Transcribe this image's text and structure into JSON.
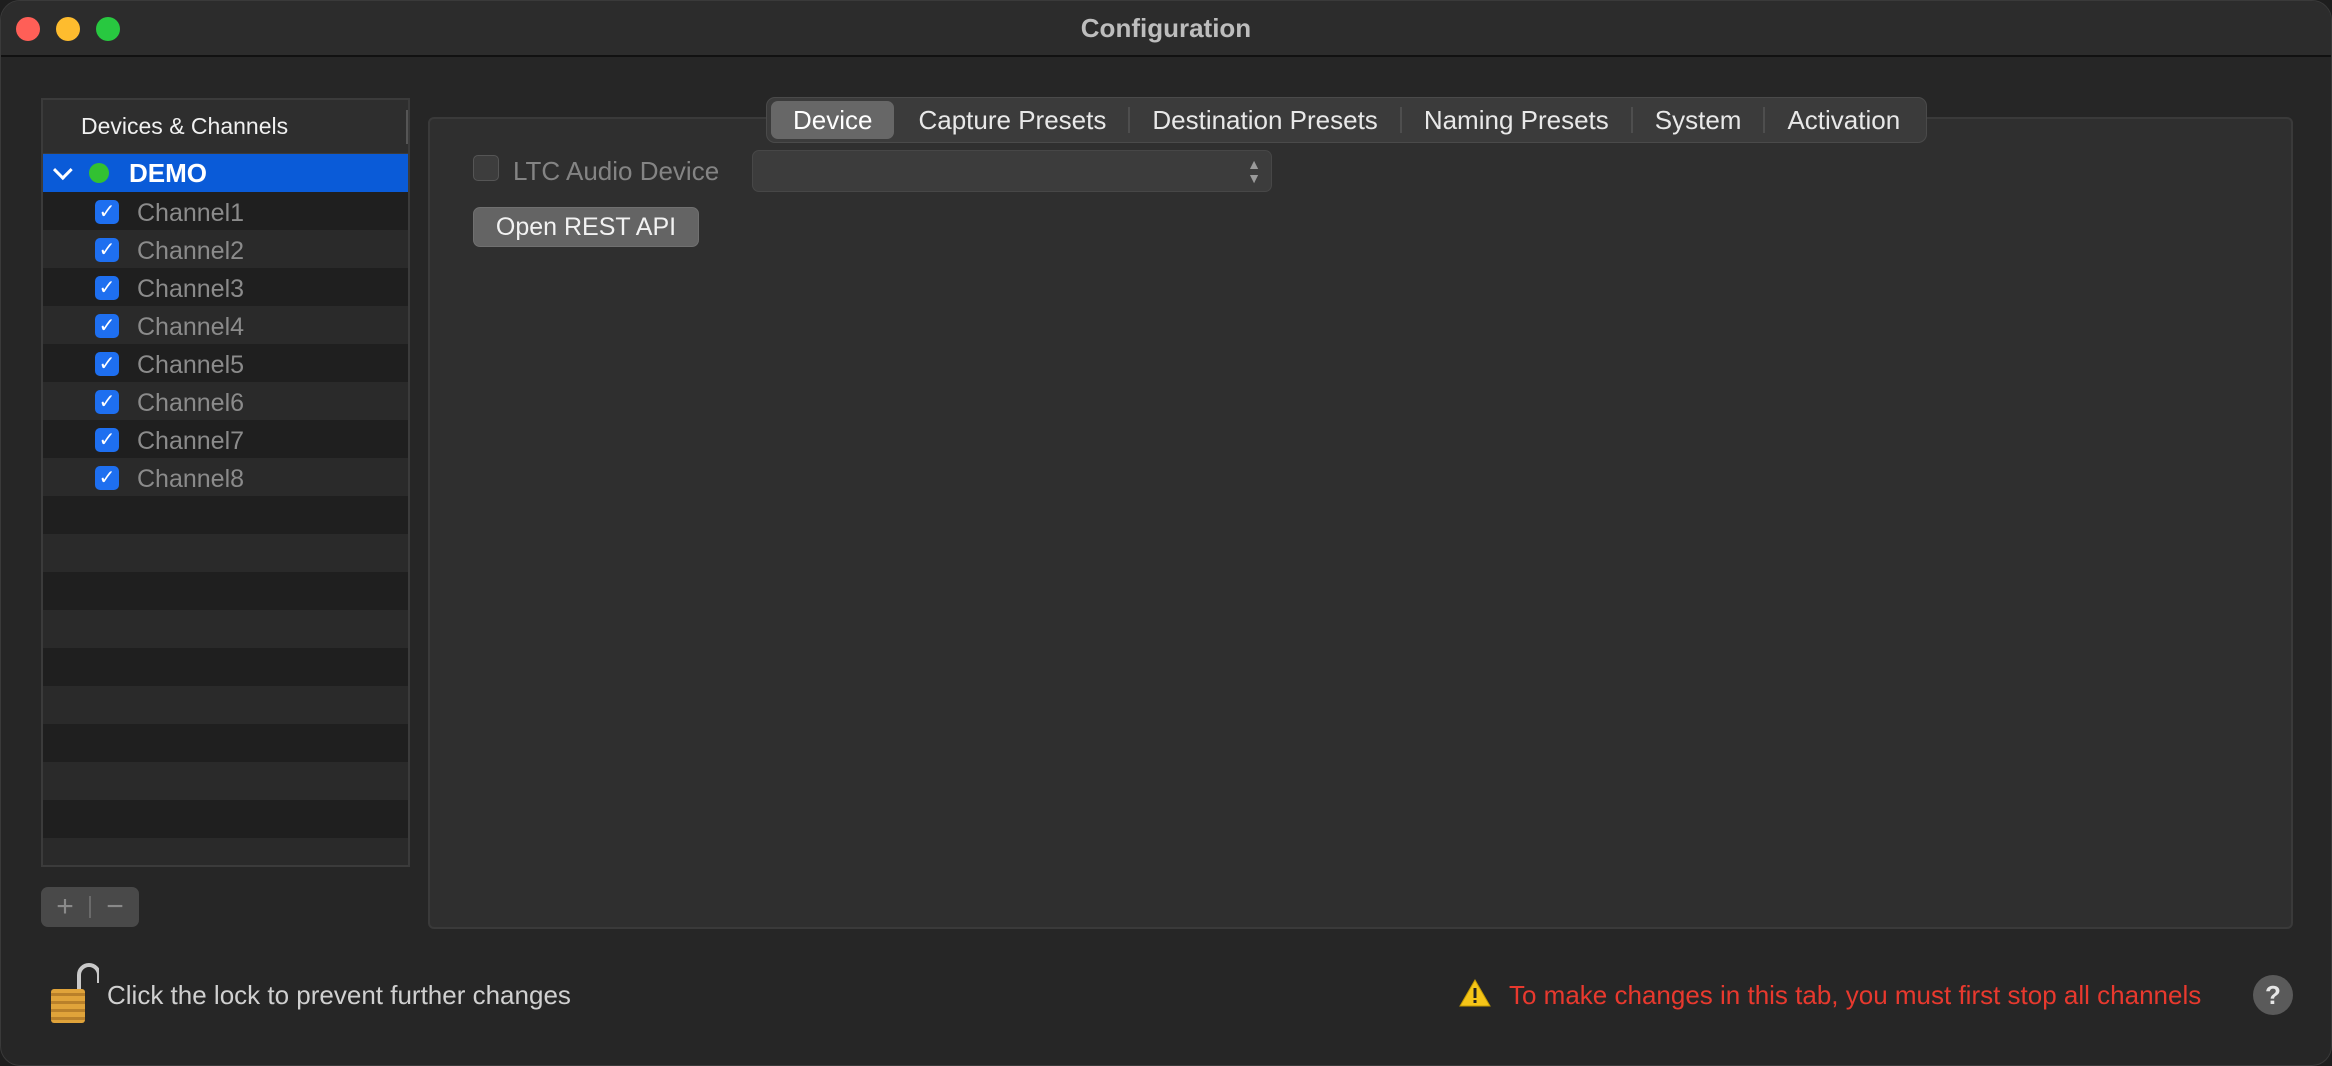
{
  "window": {
    "title": "Configuration"
  },
  "sidebar": {
    "header": "Devices & Channels",
    "device": {
      "label": "DEMO",
      "status_color": "#32c132"
    },
    "channels": [
      "Channel1",
      "Channel2",
      "Channel3",
      "Channel4",
      "Channel5",
      "Channel6",
      "Channel7",
      "Channel8"
    ],
    "add_label": "+",
    "remove_label": "−"
  },
  "tabs": [
    {
      "label": "Device",
      "active": true
    },
    {
      "label": "Capture Presets",
      "active": false
    },
    {
      "label": "Destination Presets",
      "active": false
    },
    {
      "label": "Naming Presets",
      "active": false
    },
    {
      "label": "System",
      "active": false
    },
    {
      "label": "Activation",
      "active": false
    }
  ],
  "device_tab": {
    "ltc_label": "LTC Audio Device",
    "ltc_checked": false,
    "ltc_select_value": "",
    "rest_button": "Open REST API"
  },
  "footer": {
    "lock_text": "Click the lock to prevent further changes",
    "warning_text": "To make changes in this tab, you must first stop all channels",
    "help_label": "?"
  },
  "colors": {
    "accent": "#0a5bd8",
    "checkbox": "#1e6ff0",
    "warning": "#e8392e"
  }
}
